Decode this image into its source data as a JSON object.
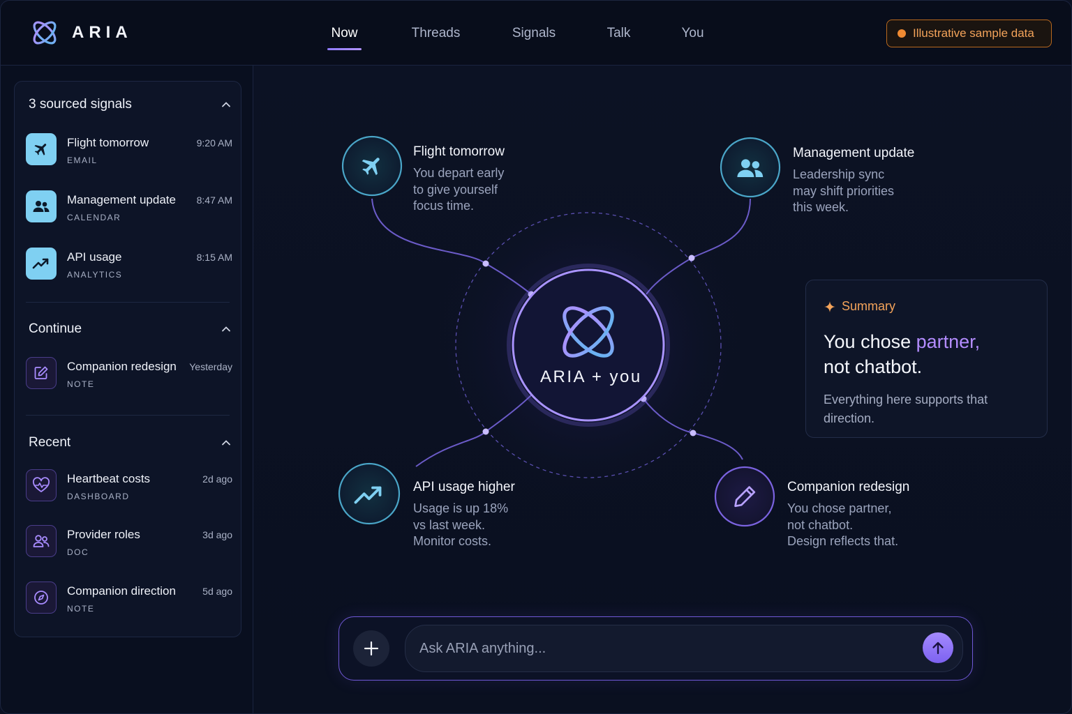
{
  "app": {
    "name": "ARIA"
  },
  "nav": {
    "tabs": [
      {
        "label": "Now",
        "active": true
      },
      {
        "label": "Threads",
        "active": false
      },
      {
        "label": "Signals",
        "active": false
      },
      {
        "label": "Talk",
        "active": false
      },
      {
        "label": "You",
        "active": false
      }
    ]
  },
  "badge": {
    "label": "Illustrative sample data",
    "color": "#f08a32"
  },
  "sidebar": {
    "signals": {
      "title": "3 sourced signals",
      "items": [
        {
          "title": "Flight tomorrow",
          "source": "EMAIL",
          "time": "9:20 AM",
          "icon": "airplane-icon"
        },
        {
          "title": "Management update",
          "source": "CALENDAR",
          "time": "8:47 AM",
          "icon": "people-icon"
        },
        {
          "title": "API usage",
          "source": "ANALYTICS",
          "time": "8:15 AM",
          "icon": "trending-up-icon"
        }
      ]
    },
    "continue": {
      "title": "Continue",
      "items": [
        {
          "title": "Companion redesign",
          "source": "NOTE",
          "time": "Yesterday",
          "icon": "edit-icon"
        }
      ]
    },
    "recent": {
      "title": "Recent",
      "items": [
        {
          "title": "Heartbeat costs",
          "source": "DASHBOARD",
          "time": "2d ago",
          "icon": "heartbeat-icon"
        },
        {
          "title": "Provider roles",
          "source": "DOC",
          "time": "3d ago",
          "icon": "users-icon"
        },
        {
          "title": "Companion direction",
          "source": "NOTE",
          "time": "5d ago",
          "icon": "compass-icon"
        }
      ]
    }
  },
  "graph": {
    "center_label": "ARIA + you",
    "nodes": [
      {
        "title": "Flight tomorrow",
        "body": "You depart early\nto give yourself\nfocus time.",
        "icon": "airplane-icon"
      },
      {
        "title": "Management update",
        "body": "Leadership sync\nmay shift priorities\nthis week.",
        "icon": "people-icon"
      },
      {
        "title": "API usage higher",
        "body": "Usage is up 18%\nvs last week.\nMonitor costs.",
        "icon": "trending-up-icon"
      },
      {
        "title": "Companion redesign",
        "body": "You chose partner,\nnot chatbot.\nDesign reflects that.",
        "icon": "pencil-icon"
      }
    ]
  },
  "summary": {
    "label": "Summary",
    "headline_pre": "You chose ",
    "headline_highlight": "partner,",
    "headline_post": "not chatbot.",
    "body": "Everything here supports that direction."
  },
  "composer": {
    "placeholder": "Ask ARIA anything..."
  },
  "colors": {
    "accent": "#8f7bff",
    "cyan": "#7fd0f2",
    "orange": "#f3a35a",
    "background": "#0b1122"
  }
}
